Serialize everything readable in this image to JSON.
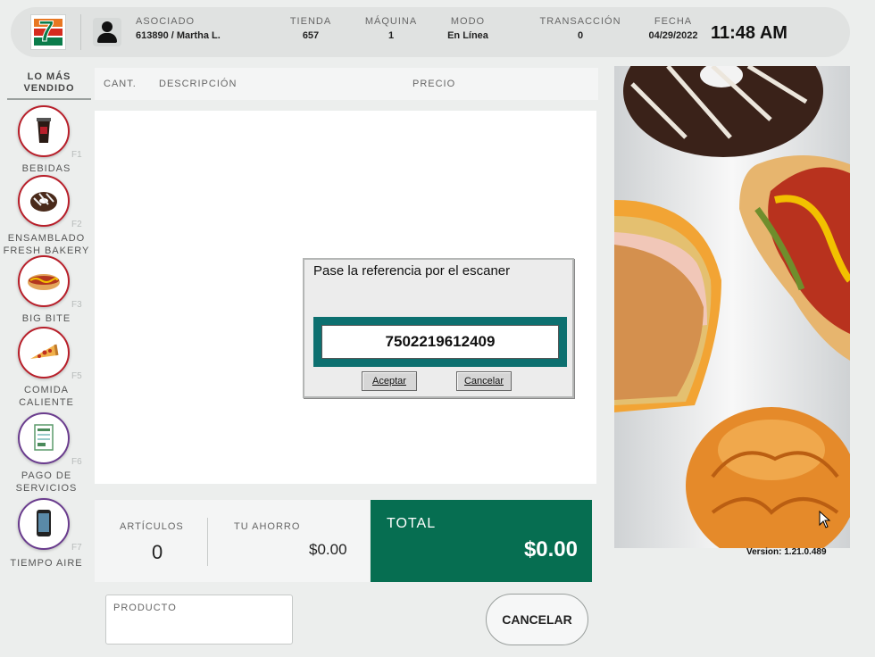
{
  "header": {
    "associate_label": "ASOCIADO",
    "associate_value": "613890 / Martha L.",
    "store_label": "TIENDA",
    "store_value": "657",
    "machine_label": "MÁQUINA",
    "machine_value": "1",
    "mode_label": "MODO",
    "mode_value": "En Línea",
    "transaction_label": "TRANSACCIÓN",
    "transaction_value": "0",
    "date_label": "FECHA",
    "date_value": "04/29/2022",
    "time": "11:48 AM",
    "logo_text": "7 ELEVEN"
  },
  "sidebar": {
    "title": "LO MÁS VENDIDO",
    "categories": [
      {
        "name": "BEBIDAS",
        "key": "F1",
        "icon": "drink-cup-icon"
      },
      {
        "name": "ENSAMBLADO FRESH BAKERY",
        "key": "F2",
        "icon": "donut-icon"
      },
      {
        "name": "BIG BITE",
        "key": "F3",
        "icon": "hotdog-icon"
      },
      {
        "name": "COMIDA CALIENTE",
        "key": "F5",
        "icon": "pizza-icon"
      },
      {
        "name": "PAGO DE SERVICIOS",
        "key": "F6",
        "icon": "bill-icon"
      },
      {
        "name": "TIEMPO AIRE",
        "key": "F7",
        "icon": "phone-icon"
      }
    ]
  },
  "table": {
    "col_qty": "CANT.",
    "col_desc": "DESCRIPCIÓN",
    "col_price": "PRECIO"
  },
  "dialog": {
    "title": "Pase la referencia por el escaner",
    "input_value": "7502219612409",
    "accept_label": "Aceptar",
    "cancel_label": "Cancelar"
  },
  "totals": {
    "items_label": "ARTÍCULOS",
    "items_value": "0",
    "savings_label": "TU AHORRO",
    "savings_value": "$0.00",
    "total_label": "TOTAL",
    "total_value": "$0.00"
  },
  "bottom": {
    "product_label": "PRODUCTO",
    "cancel_button": "CANCELAR"
  },
  "promo": {
    "version": "Version: 1.21.0.489"
  },
  "colors": {
    "brand_green": "#066e51",
    "dialog_teal": "#0d7070",
    "category_red": "#b81f2a",
    "category_purple": "#6a3c8e"
  }
}
